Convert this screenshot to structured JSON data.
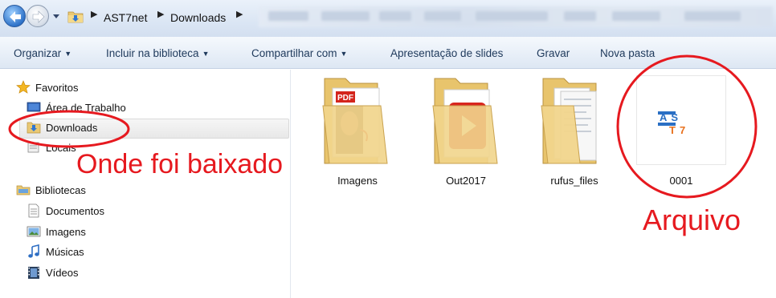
{
  "breadcrumb": {
    "items": [
      "AST7net",
      "Downloads"
    ]
  },
  "toolbar": {
    "organize": "Organizar",
    "include_library": "Incluir na biblioteca",
    "share_with": "Compartilhar com",
    "slideshow": "Apresentação de slides",
    "burn": "Gravar",
    "new_folder": "Nova pasta"
  },
  "navpane": {
    "favorites": {
      "label": "Favoritos",
      "items": [
        "Área de Trabalho",
        "Downloads",
        "Locais"
      ]
    },
    "libraries": {
      "label": "Bibliotecas",
      "items": [
        "Documentos",
        "Imagens",
        "Músicas",
        "Vídeos"
      ]
    }
  },
  "content": {
    "items": [
      {
        "name": "Imagens",
        "icon": "folder-pdf-icon"
      },
      {
        "name": "Out2017",
        "icon": "folder-video-icon"
      },
      {
        "name": "rufus_files",
        "icon": "folder-documents-icon"
      },
      {
        "name": "0001",
        "icon": "ast7-image-icon"
      }
    ],
    "ast7_logo": {
      "line1": "AS",
      "line2": "T7"
    }
  },
  "annotations": {
    "downloads_note": "Onde foi baixado",
    "file_note": "Arquivo",
    "color": "#e6191f"
  },
  "colors": {
    "toolbar_text": "#1e395b",
    "selection": "#e8e8e8",
    "annotation": "#e6191f"
  }
}
